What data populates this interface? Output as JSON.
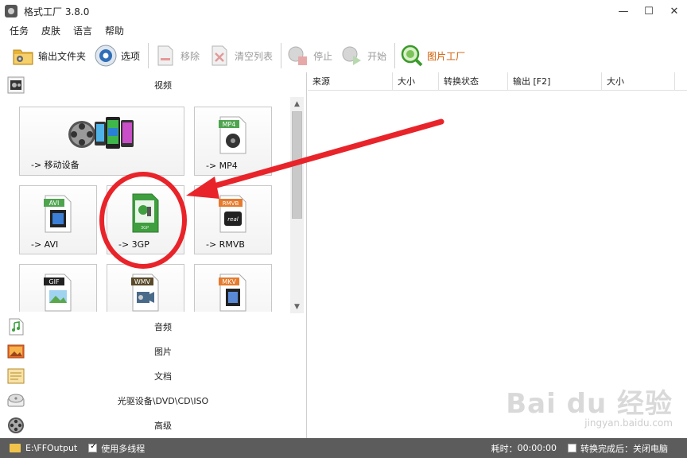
{
  "window": {
    "title": "格式工厂 3.8.0",
    "minimize": "—",
    "maximize": "☐",
    "close": "✕"
  },
  "menu": [
    "任务",
    "皮肤",
    "语言",
    "帮助"
  ],
  "toolbar": {
    "output_folder": "输出文件夹",
    "options": "选项",
    "remove": "移除",
    "clear_list": "清空列表",
    "stop": "停止",
    "start": "开始",
    "picture_factory": "图片工厂"
  },
  "left": {
    "video": "视频",
    "tiles": [
      {
        "label": "-> 移动设备"
      },
      {
        "label": "-> MP4",
        "badge": "MP4"
      },
      {
        "label": "-> AVI",
        "badge": "AVI"
      },
      {
        "label": "-> 3GP",
        "badge": "3GP"
      },
      {
        "label": "-> RMVB",
        "badge": "RMVB"
      },
      {
        "badge": "GIF"
      },
      {
        "badge": "WMV"
      },
      {
        "badge": "MKV"
      }
    ],
    "categories": [
      "音频",
      "图片",
      "文档",
      "光驱设备\\DVD\\CD\\ISO",
      "高级"
    ]
  },
  "table": {
    "columns": [
      "来源",
      "大小",
      "转换状态",
      "输出 [F2]",
      "大小"
    ]
  },
  "status": {
    "path": "E:\\FFOutput",
    "multithread": "使用多线程",
    "elapsed_label": "耗时：",
    "elapsed_value": "00:00:00",
    "after_convert": "转换完成后：关闭电脑"
  },
  "watermark": {
    "main": "Bai du 经验",
    "sub": "jingyan.baidu.com"
  },
  "colors": {
    "annotation_red": "#e8242a",
    "status_bg": "#5c5c5c",
    "highlight_text": "#d05a00"
  }
}
